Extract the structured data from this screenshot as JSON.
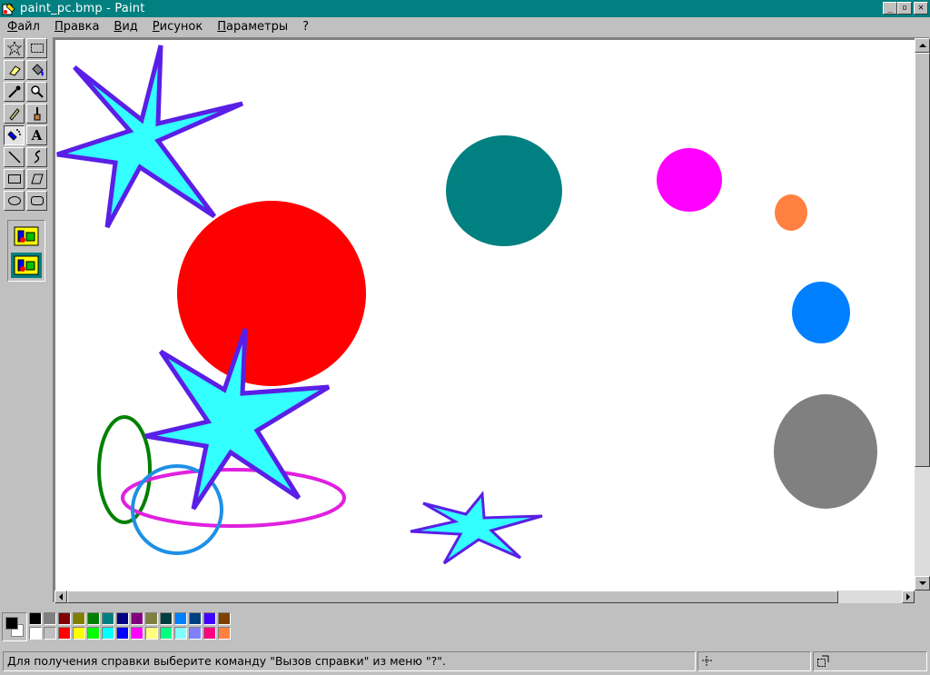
{
  "window": {
    "title": "paint_pc.bmp - Paint",
    "buttons": {
      "minimize": "_",
      "maximize": "▫",
      "close": "✕"
    }
  },
  "menu": {
    "items": [
      "Файл",
      "Правка",
      "Вид",
      "Рисунок",
      "Параметры",
      "?"
    ]
  },
  "toolbox": {
    "tools": [
      {
        "name": "free-select-icon",
        "glyph": "☆"
      },
      {
        "name": "rect-select-icon",
        "glyph": "⬚"
      },
      {
        "name": "eraser-icon",
        "glyph": "⌫"
      },
      {
        "name": "fill-bucket-icon",
        "glyph": "▼"
      },
      {
        "name": "eyedropper-icon",
        "glyph": "⟋"
      },
      {
        "name": "magnifier-icon",
        "glyph": "⚲"
      },
      {
        "name": "pencil-icon",
        "glyph": "✎"
      },
      {
        "name": "brush-icon",
        "glyph": "♙"
      },
      {
        "name": "airbrush-icon",
        "glyph": "≋"
      },
      {
        "name": "text-icon",
        "glyph": "A"
      },
      {
        "name": "line-icon",
        "glyph": "╲"
      },
      {
        "name": "curve-icon",
        "glyph": "∫"
      },
      {
        "name": "rectangle-icon",
        "glyph": "▭"
      },
      {
        "name": "polygon-icon",
        "glyph": "⏢"
      },
      {
        "name": "ellipse-icon",
        "glyph": "⬭"
      },
      {
        "name": "rounded-rect-icon",
        "glyph": "▢"
      }
    ]
  },
  "palette": {
    "foreground": "#000000",
    "background": "#ffffff",
    "colors_row1": [
      "#000000",
      "#808080",
      "#800000",
      "#808000",
      "#008000",
      "#008080",
      "#000080",
      "#800080",
      "#808040",
      "#004040",
      "#0080ff",
      "#004080",
      "#4000ff",
      "#804000"
    ],
    "colors_row2": [
      "#ffffff",
      "#c0c0c0",
      "#ff0000",
      "#ffff00",
      "#00ff00",
      "#00ffff",
      "#0000ff",
      "#ff00ff",
      "#ffff80",
      "#00ff80",
      "#80ffff",
      "#8080ff",
      "#ff0080",
      "#ff8040"
    ]
  },
  "status": {
    "help_text": "Для получения справки выберите команду \"Вызов справки\" из меню \"?\".",
    "position": "",
    "size": ""
  },
  "drawing": {
    "colors": {
      "red": "#ff0000",
      "teal": "#008080",
      "magenta": "#ff00ff",
      "orange": "#ff8040",
      "blue": "#0080ff",
      "gray": "#808080",
      "star_fill": "#33ffff",
      "star_stroke": "#5a1fe6",
      "green_ellipse": "#008000",
      "magenta_ellipse": "#e020e0",
      "blue_ellipse": "#1e90e6"
    }
  }
}
